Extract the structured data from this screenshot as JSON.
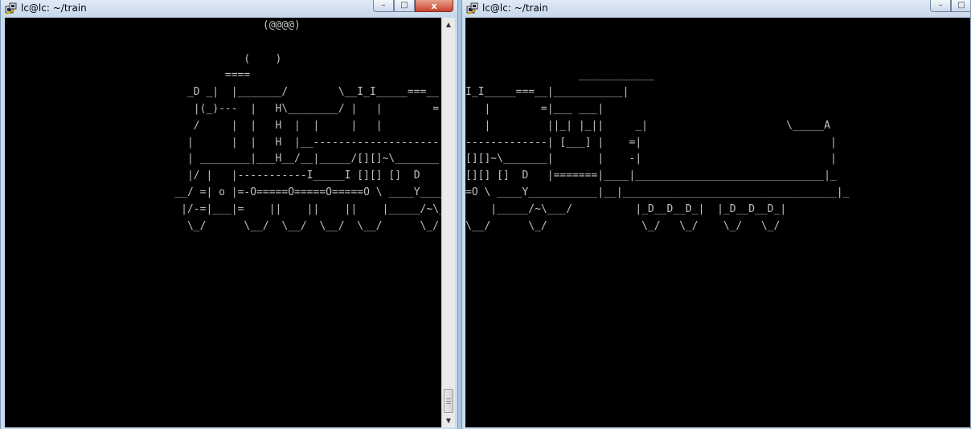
{
  "windows": [
    {
      "title": "lc@lc: ~/train",
      "controls": {
        "minimize": "–",
        "maximize": "□",
        "close": "x"
      },
      "terminal_text": "                                         (@@@@)\n\n                                      (    )\n                                   ====\n                             _D _|  |_______/        \\__I_I_____===__|_________|\n                              |(_)---  |   H\\________/ |   |        =|___ ___|\n                              /     |  |   H  |  |     |   |         ||_| |_||\n                             |      |  |   H  |__--------------------| [___] |\n                             | ________|___H__/__|_____/[][]~\\_______|       |\n                             |/ |   |-----------I_____I [][] []  D   |=======|__\n                           __/ =| o |=-O=====O=====O=====O \\ ____Y___________|__\n                            |/-=|___|=    ||    ||    ||    |_____/~\\___/\n                             \\_/      \\__/  \\__/  \\__/  \\__/      \\_/",
      "scrollbar": {
        "up_arrow": "▲",
        "down_arrow": "▼"
      }
    },
    {
      "title": "lc@lc: ~/train",
      "controls": {
        "minimize": "–",
        "maximize": "□"
      },
      "terminal_text": "\n\n\n                  ____________\nI_I_____===__|___________|\n   |        =|___ ___|\n   |         ||_| |_||     _|                      \\_____A\n-------------| [___] |    =|                              |\n[][]~\\_______|       |    -|                              |\n[][] []  D   |=======|____|______________________________|_\n=O \\ ____Y___________|__|__________________________________|_\n    |_____/~\\___/          |_D__D__D_|  |_D__D__D_|\n\\__/      \\_/               \\_/   \\_/    \\_/   \\_/"
    }
  ]
}
